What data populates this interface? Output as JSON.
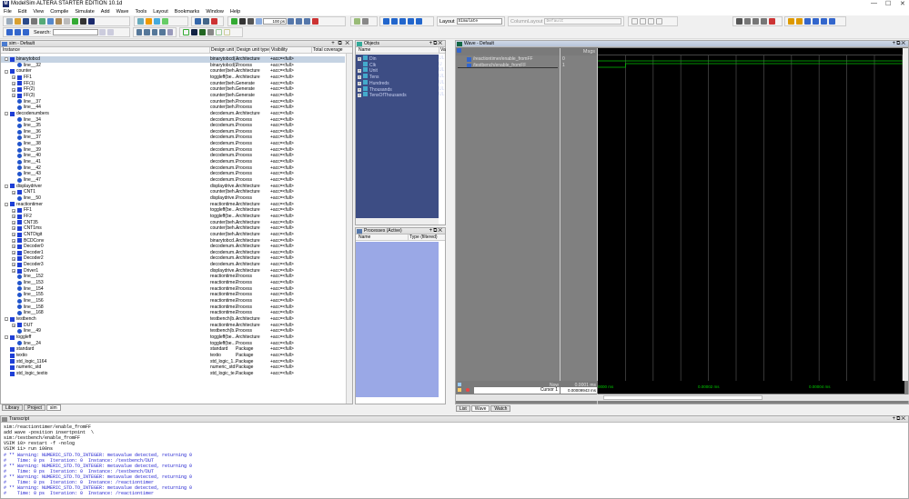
{
  "window": {
    "title": "ModelSim ALTERA STARTER EDITION 10.1d",
    "controls": [
      "—",
      "☐",
      "✕"
    ]
  },
  "menu": [
    "File",
    "Edit",
    "View",
    "Compile",
    "Simulate",
    "Add",
    "Wave",
    "Tools",
    "Layout",
    "Bookmarks",
    "Window",
    "Help"
  ],
  "toolbar": {
    "run_length": "100 ps",
    "search_label": "Search:",
    "search_value": "",
    "layout_label": "Layout",
    "layout_value": "Simulate",
    "column_layout_label": "ColumnLayout",
    "column_layout_value": "Default"
  },
  "sim": {
    "title": "sim - Default",
    "columns": [
      "Instance",
      "Design unit",
      "Design unit type",
      "Visibility",
      "Total coverage"
    ],
    "rows": [
      [
        "binarytobcd",
        0,
        "-",
        "a",
        "binarytobcd(...",
        "Architecture"
      ],
      [
        "line__32",
        1,
        "",
        "p",
        "binarytobcd(...",
        "Process"
      ],
      [
        "counter",
        0,
        "-",
        "a",
        "counter(beh...",
        "Architecture"
      ],
      [
        "FF1",
        1,
        "+",
        "a",
        "toggleff(be...",
        "Architecture"
      ],
      [
        "FF(1)",
        1,
        "+",
        "a",
        "counter(beh...",
        "Generate"
      ],
      [
        "FF(2)",
        1,
        "+",
        "a",
        "counter(beh...",
        "Generate"
      ],
      [
        "FF(3)",
        1,
        "+",
        "a",
        "counter(beh...",
        "Generate"
      ],
      [
        "line__37",
        1,
        "",
        "p",
        "counter(beh...",
        "Process"
      ],
      [
        "line__44",
        1,
        "",
        "p",
        "counter(beh...",
        "Process"
      ],
      [
        "decodenumbers",
        0,
        "-",
        "a",
        "decodenum...",
        "Architecture"
      ],
      [
        "line__34",
        1,
        "",
        "p",
        "decodenum...",
        "Process"
      ],
      [
        "line__35",
        1,
        "",
        "p",
        "decodenum...",
        "Process"
      ],
      [
        "line__36",
        1,
        "",
        "p",
        "decodenum...",
        "Process"
      ],
      [
        "line__37",
        1,
        "",
        "p",
        "decodenum...",
        "Process"
      ],
      [
        "line__38",
        1,
        "",
        "p",
        "decodenum...",
        "Process"
      ],
      [
        "line__39",
        1,
        "",
        "p",
        "decodenum...",
        "Process"
      ],
      [
        "line__40",
        1,
        "",
        "p",
        "decodenum...",
        "Process"
      ],
      [
        "line__41",
        1,
        "",
        "p",
        "decodenum...",
        "Process"
      ],
      [
        "line__42",
        1,
        "",
        "p",
        "decodenum...",
        "Process"
      ],
      [
        "line__43",
        1,
        "",
        "p",
        "decodenum...",
        "Process"
      ],
      [
        "line__47",
        1,
        "",
        "p",
        "decodenum...",
        "Process"
      ],
      [
        "displaydriver",
        0,
        "-",
        "a",
        "displaydrive...",
        "Architecture"
      ],
      [
        "CNT1",
        1,
        "+",
        "a",
        "counter(beh...",
        "Architecture"
      ],
      [
        "line__50",
        1,
        "",
        "p",
        "displaydrive...",
        "Process"
      ],
      [
        "reactiontimer",
        0,
        "-",
        "a",
        "reactiontime...",
        "Architecture"
      ],
      [
        "FF1",
        1,
        "+",
        "a",
        "toggleff(be...",
        "Architecture"
      ],
      [
        "FF2",
        1,
        "+",
        "a",
        "toggleff(be...",
        "Architecture"
      ],
      [
        "CNT35",
        1,
        "+",
        "a",
        "counter(beh...",
        "Architecture"
      ],
      [
        "CNT1ms",
        1,
        "+",
        "a",
        "counter(beh...",
        "Architecture"
      ],
      [
        "CNTDigit",
        1,
        "+",
        "a",
        "counter(beh...",
        "Architecture"
      ],
      [
        "BCDConv",
        1,
        "+",
        "a",
        "binarytobcd...",
        "Architecture"
      ],
      [
        "Decoder0",
        1,
        "+",
        "a",
        "decodenum...",
        "Architecture"
      ],
      [
        "Decoder1",
        1,
        "+",
        "a",
        "decodenum...",
        "Architecture"
      ],
      [
        "Decoder2",
        1,
        "+",
        "a",
        "decodenum...",
        "Architecture"
      ],
      [
        "Decoder3",
        1,
        "+",
        "a",
        "decodenum...",
        "Architecture"
      ],
      [
        "Driver1",
        1,
        "+",
        "a",
        "displaydrive...",
        "Architecture"
      ],
      [
        "line__152",
        1,
        "",
        "p",
        "reactiontime...",
        "Process"
      ],
      [
        "line__153",
        1,
        "",
        "p",
        "reactiontime...",
        "Process"
      ],
      [
        "line__154",
        1,
        "",
        "p",
        "reactiontime...",
        "Process"
      ],
      [
        "line__155",
        1,
        "",
        "p",
        "reactiontime...",
        "Process"
      ],
      [
        "line__156",
        1,
        "",
        "p",
        "reactiontime...",
        "Process"
      ],
      [
        "line__158",
        1,
        "",
        "p",
        "reactiontime...",
        "Process"
      ],
      [
        "line__168",
        1,
        "",
        "p",
        "reactiontime...",
        "Process"
      ],
      [
        "testbench",
        0,
        "-",
        "a",
        "testbench(b...",
        "Architecture"
      ],
      [
        "DUT",
        1,
        "+",
        "a",
        "reactiontime...",
        "Architecture"
      ],
      [
        "line__49",
        1,
        "",
        "p",
        "testbench(b...",
        "Process"
      ],
      [
        "toggleff",
        0,
        "-",
        "a",
        "toggleff(be...",
        "Architecture"
      ],
      [
        "line__24",
        1,
        "",
        "p",
        "toggleff(be...",
        "Process"
      ],
      [
        "standard",
        0,
        "",
        "a",
        "standard",
        "Package"
      ],
      [
        "textio",
        0,
        "",
        "a",
        "textio",
        "Package"
      ],
      [
        "std_logic_1164",
        0,
        "",
        "a",
        "std_logic_1...",
        "Package"
      ],
      [
        "numeric_std",
        0,
        "",
        "a",
        "numeric_std",
        "Package"
      ],
      [
        "std_logic_textio",
        0,
        "",
        "a",
        "std_logic_te...",
        "Package"
      ]
    ],
    "visibility": "+acc=<full>",
    "tabs": [
      "Library",
      "Project",
      "sim"
    ]
  },
  "objects": {
    "title": "Objects",
    "columns": [
      "Name",
      "Va"
    ],
    "items": [
      [
        "Din",
        "UL"
      ],
      [
        "Clk",
        "U"
      ],
      [
        "Unit",
        "UL"
      ],
      [
        "Tens",
        "UL"
      ],
      [
        "Hundreds",
        "UL"
      ],
      [
        "Thousands",
        "UL"
      ],
      [
        "TensOfThousands",
        "UL"
      ]
    ]
  },
  "processes": {
    "title": "Processes (Active)",
    "columns": [
      "Name",
      "Type (filtered)"
    ]
  },
  "wave": {
    "title": "Wave - Default",
    "msgs_header": "Msgs",
    "signals": [
      {
        "name": "/reactiontimer/enable_fromFF",
        "value": "0"
      },
      {
        "name": "/testbench/enable_fromFF",
        "value": "1"
      }
    ],
    "now_label": "Now",
    "now_value": "0.0001 ms",
    "cursor_label": "Cursor 1",
    "cursor_value": "0.00009943 ms",
    "time_ticks": [
      "0000 ms",
      "0.00002 ms",
      "0.00004 ms"
    ],
    "tabs": [
      "List",
      "Wave",
      "Watch"
    ],
    "trace_color": "#00c000"
  },
  "transcript": {
    "title": "Transcript",
    "lines": [
      {
        "t": "sim:/reactiontimer/enable_fromFF",
        "c": "#000"
      },
      {
        "t": "add wave -position insertpoint  \\",
        "c": "#000"
      },
      {
        "t": "sim:/testbench/enable_fromFF",
        "c": "#000"
      },
      {
        "t": "VSIM 10> restart -f -nolog",
        "c": "#000"
      },
      {
        "t": "VSIM 11> run 100ns",
        "c": "#000"
      },
      {
        "t": "# ** Warning: NUMERIC_STD.TO_INTEGER: metavalue detected, returning 0",
        "c": "#2020d0"
      },
      {
        "t": "#    Time: 0 ps  Iteration: 0  Instance: /testbench/DUT",
        "c": "#2020d0"
      },
      {
        "t": "# ** Warning: NUMERIC_STD.TO_INTEGER: metavalue detected, returning 0",
        "c": "#2020d0"
      },
      {
        "t": "#    Time: 0 ps  Iteration: 0  Instance: /testbench/DUT",
        "c": "#2020d0"
      },
      {
        "t": "# ** Warning: NUMERIC_STD.TO_INTEGER: metavalue detected, returning 0",
        "c": "#2020d0"
      },
      {
        "t": "#    Time: 0 ps  Iteration: 0  Instance: /reactiontimer",
        "c": "#2020d0"
      },
      {
        "t": "# ** Warning: NUMERIC_STD.TO_INTEGER: metavalue detected, returning 0",
        "c": "#2020d0"
      },
      {
        "t": "#    Time: 0 ps  Iteration: 0  Instance: /reactiontimer",
        "c": "#2020d0"
      }
    ]
  }
}
